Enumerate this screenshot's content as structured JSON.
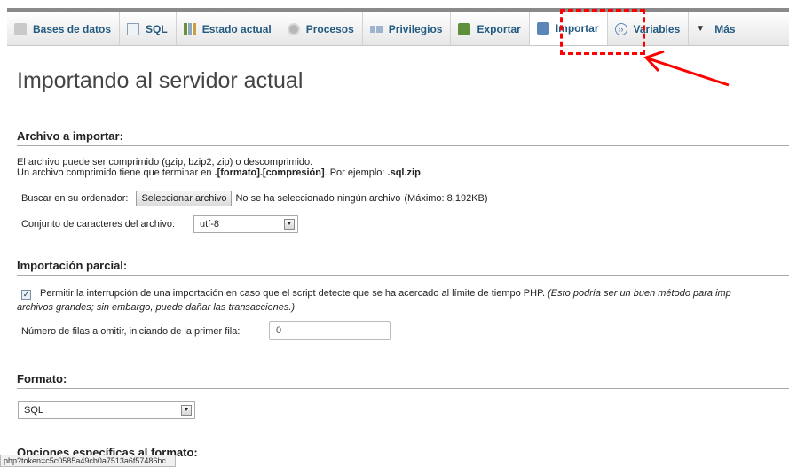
{
  "tabs": [
    {
      "label": "Bases de datos",
      "icon": "database-icon"
    },
    {
      "label": "SQL",
      "icon": "sql-icon"
    },
    {
      "label": "Estado actual",
      "icon": "status-icon"
    },
    {
      "label": "Procesos",
      "icon": "processes-icon"
    },
    {
      "label": "Privilegios",
      "icon": "privileges-icon"
    },
    {
      "label": "Exportar",
      "icon": "export-icon"
    },
    {
      "label": "Importar",
      "icon": "import-icon",
      "active": true
    },
    {
      "label": "Variables",
      "icon": "variables-icon"
    },
    {
      "label": "Más",
      "icon": "chevron-down-icon"
    }
  ],
  "page": {
    "title": "Importando al servidor actual"
  },
  "file_section": {
    "heading": "Archivo a importar:",
    "desc_line1": "El archivo puede ser comprimido (gzip, bzip2, zip) o descomprimido.",
    "desc_line2_prefix": "Un archivo comprimido tiene que terminar en ",
    "desc_line2_format": ".[formato].[compresión]",
    "desc_line2_mid": ". Por ejemplo: ",
    "desc_line2_example": ".sql.zip",
    "browse_label": "Buscar en su ordenador:",
    "browse_button": "Seleccionar archivo",
    "no_file_text": "No se ha seleccionado ningún archivo",
    "max_text": "(Máximo: 8,192KB)",
    "charset_label": "Conjunto de caracteres del archivo:",
    "charset_value": "utf-8"
  },
  "partial_section": {
    "heading": "Importación parcial:",
    "allow_interrupt_checked": true,
    "allow_interrupt_text": "Permitir la interrupción de una importación en caso que el script detecte que se ha acercado al límite de tiempo PHP.",
    "allow_interrupt_note": "(Esto podría ser un buen método para imp",
    "allow_interrupt_note2": "archivos grandes; sin embargo, puede dañar las transacciones.)",
    "skip_rows_label": "Número de filas a omitir, iniciando de la primer fila:",
    "skip_rows_value": "0"
  },
  "format_section": {
    "heading": "Formato:",
    "format_value": "SQL",
    "options_heading": "Opciones específicas al formato:"
  },
  "statusbar": {
    "url": "php?token=c5c0585a49cb0a7513a6f57486bc..."
  },
  "colors": {
    "tab_text": "#235a81",
    "highlight": "#ff0000"
  }
}
